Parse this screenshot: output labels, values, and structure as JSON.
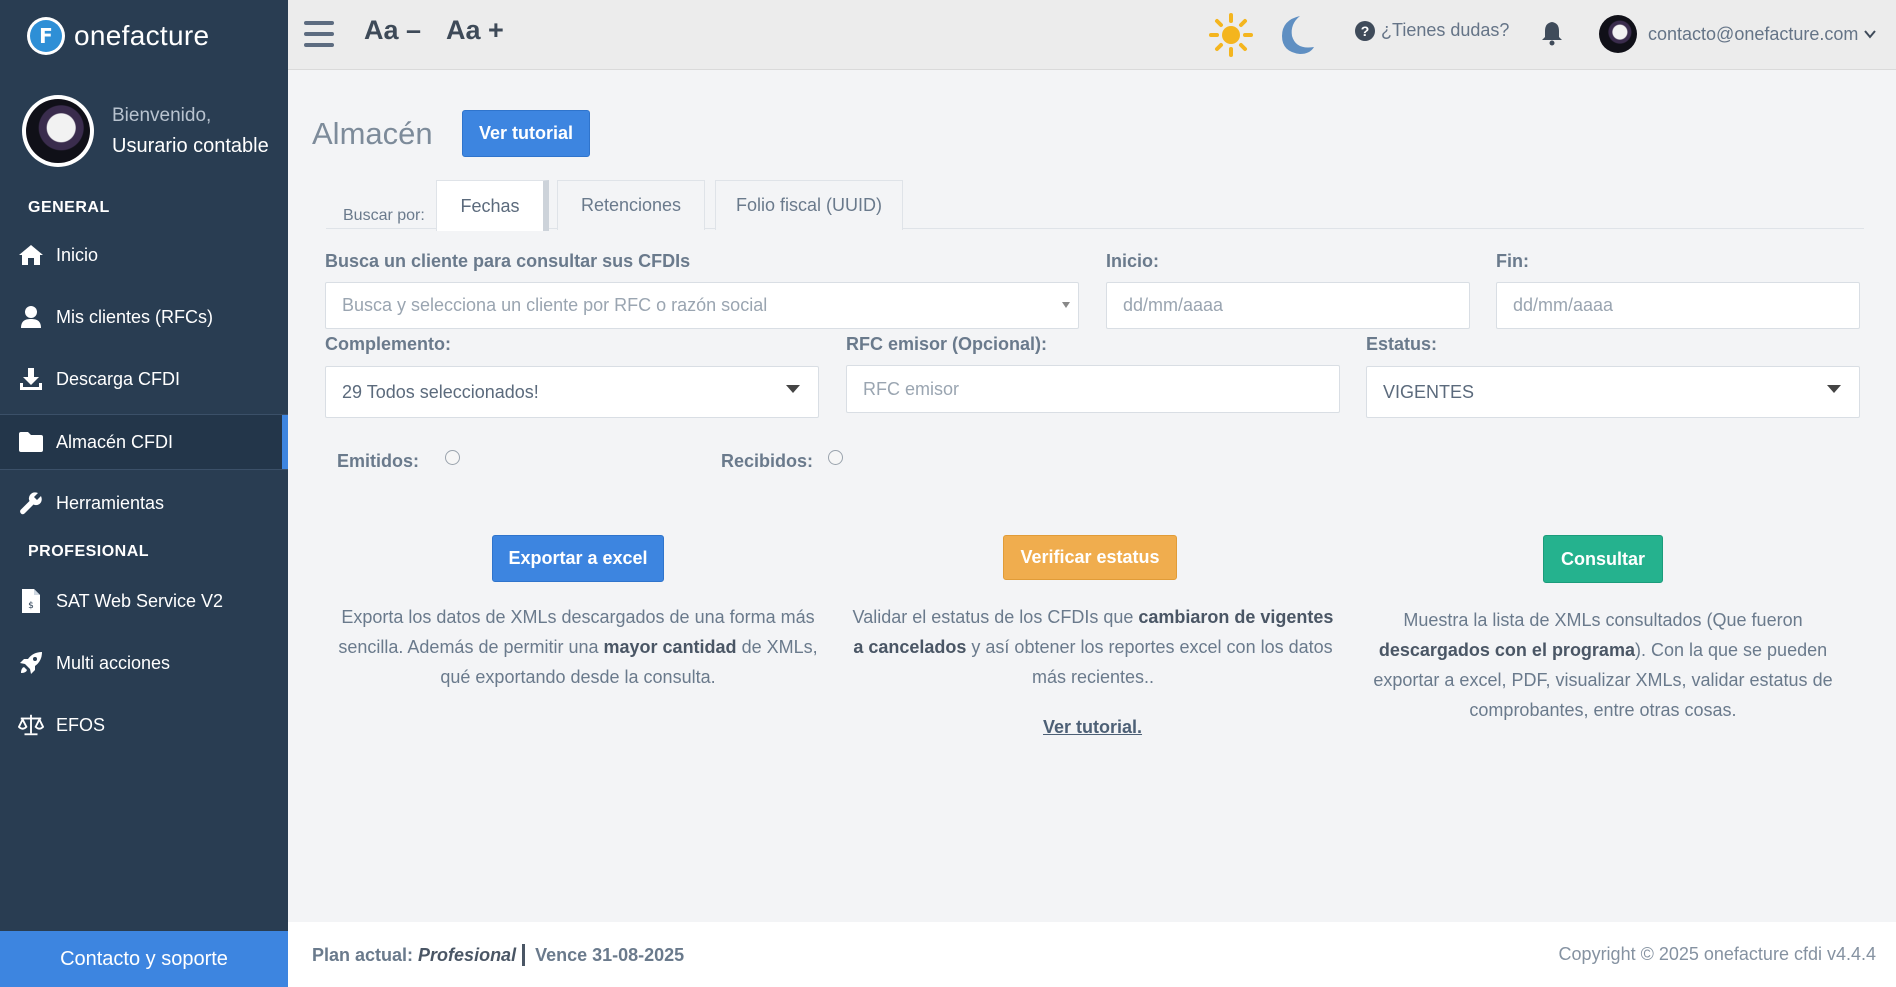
{
  "brand": {
    "name": "onefacture",
    "logo_letter": "F"
  },
  "user": {
    "greeting": "Bienvenido,",
    "name": "Usurario contable"
  },
  "sidebar": {
    "sections": [
      {
        "title": "GENERAL"
      },
      {
        "title": "PROFESIONAL"
      }
    ],
    "items": [
      {
        "label": "Inicio",
        "icon": "home-icon"
      },
      {
        "label": "Mis clientes (RFCs)",
        "icon": "user-icon"
      },
      {
        "label": "Descarga CFDI",
        "icon": "download-icon"
      },
      {
        "label": "Almacén CFDI",
        "icon": "folder-icon",
        "active": true
      },
      {
        "label": "Herramientas",
        "icon": "wrench-icon"
      },
      {
        "label": "SAT Web Service V2",
        "icon": "file-icon"
      },
      {
        "label": "Multi acciones",
        "icon": "rocket-icon"
      },
      {
        "label": "EFOS",
        "icon": "balance-scale-icon"
      }
    ],
    "support_label": "Contacto y soporte"
  },
  "topbar": {
    "font_decrease": "Aa –",
    "font_increase": "Aa +",
    "help_label": "¿Tienes dudas?",
    "account_email": "contacto@onefacture.com",
    "colors": {
      "sun": "#f4b51e",
      "moon": "#5f8fc2"
    }
  },
  "main": {
    "title": "Almacén",
    "tutorial_button": "Ver tutorial",
    "search_by_label": "Buscar por:",
    "tabs": [
      {
        "label": "Fechas",
        "active": true
      },
      {
        "label": "Retenciones"
      },
      {
        "label": "Folio fiscal (UUID)"
      }
    ],
    "client_label": "Busca un cliente para consultar sus CFDIs",
    "client_placeholder": "Busca y selecciona un cliente por RFC o razón social",
    "start_label": "Inicio:",
    "start_placeholder": "dd/mm/aaaa",
    "end_label": "Fin:",
    "end_placeholder": "dd/mm/aaaa",
    "complement_label": "Complemento:",
    "complement_value": "29 Todos seleccionados!",
    "rfc_label": "RFC emisor (Opcional):",
    "rfc_placeholder": "RFC emisor",
    "status_label": "Estatus:",
    "status_value": "VIGENTES",
    "emitidos_label": "Emitidos:",
    "recibidos_label": "Recibidos:",
    "actions": [
      {
        "button": "Exportar a excel",
        "desc_parts": [
          "Exporta los datos de XMLs descargados de una forma más sencilla. Además de permitir una ",
          "mayor cantidad",
          " de XMLs, qué exportando desde la consulta."
        ]
      },
      {
        "button": "Verificar estatus",
        "desc_parts": [
          "Validar el estatus de los CFDIs que ",
          "cambiaron de vigentes a cancelados",
          " y así obtener los reportes excel con los datos más recientes.."
        ],
        "link": "Ver tutorial."
      },
      {
        "button": "Consultar",
        "desc_parts": [
          "Muestra la lista de XMLs consultados (Que fueron ",
          "descargados con el programa",
          "). Con la que se pueden exportar a excel, PDF, visualizar XMLs, validar estatus de comprobantes, entre otras cosas."
        ]
      }
    ]
  },
  "footer": {
    "plan_label": "Plan actual:",
    "plan_value": "Profesional",
    "expires": "Vence 31-08-2025",
    "copyright": "Copyright © 2025 onefacture cfdi v4.4.4"
  }
}
